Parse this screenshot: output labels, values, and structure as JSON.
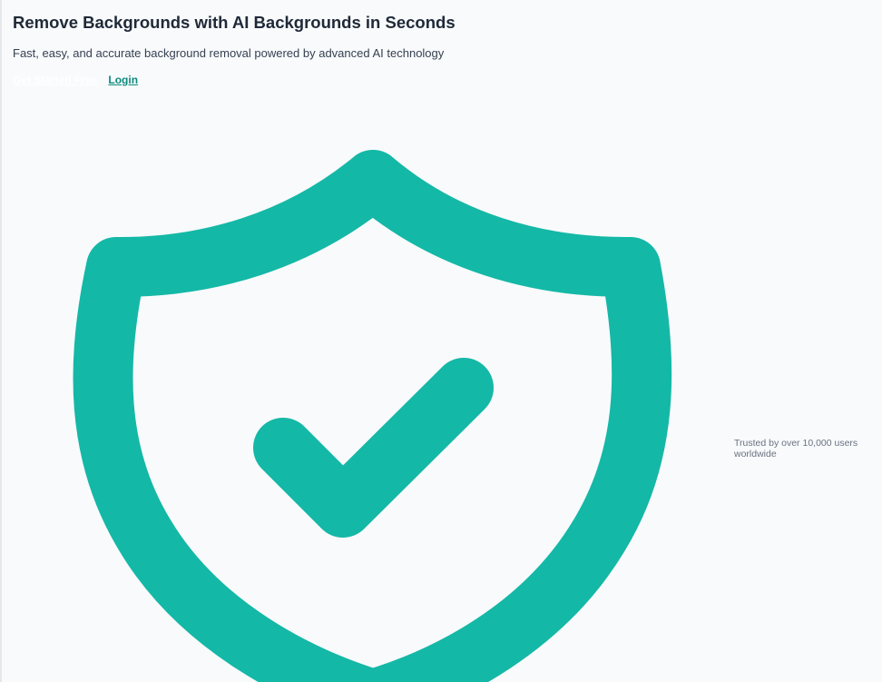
{
  "hero": {
    "title": "Remove Backgrounds with AI Backgrounds in Seconds",
    "subtitle": "Fast, easy, and accurate background removal powered by advanced AI technology",
    "cta_primary": "Get Started Free",
    "cta_login": "Login"
  },
  "illustration": {
    "icon": "shield-check-icon",
    "color": "#14b8a6"
  },
  "trust": {
    "text": "Trusted by over 10,000 users worldwide"
  }
}
